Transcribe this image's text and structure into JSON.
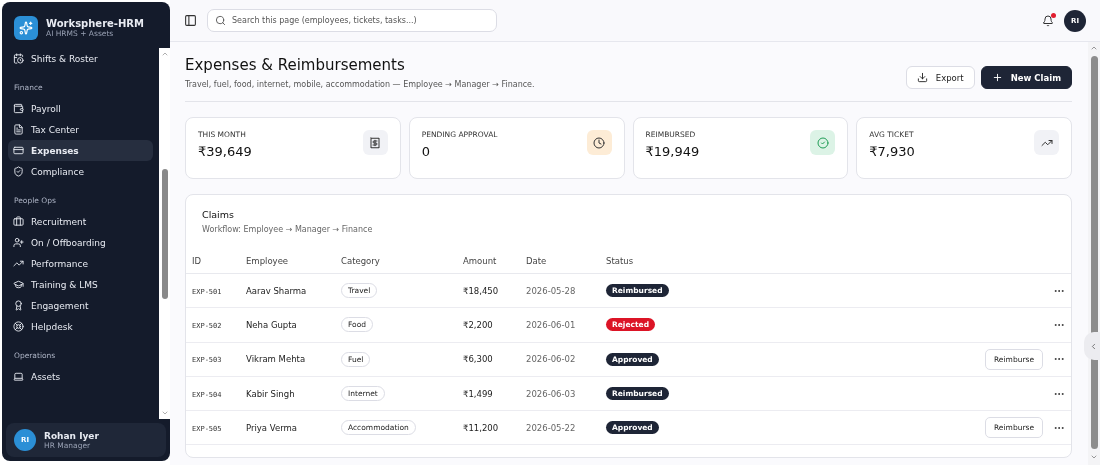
{
  "sidebar": {
    "brand": {
      "name": "Worksphere-HRM",
      "tagline": "AI HRMS + Assets"
    },
    "groups": [
      {
        "items": [
          {
            "label": "Shifts & Roster",
            "selected": false
          }
        ]
      },
      {
        "label": "Finance",
        "items": [
          {
            "label": "Payroll",
            "selected": false
          },
          {
            "label": "Tax Center",
            "selected": false
          },
          {
            "label": "Expenses",
            "selected": true
          },
          {
            "label": "Compliance",
            "selected": false
          }
        ]
      },
      {
        "label": "People Ops",
        "items": [
          {
            "label": "Recruitment",
            "selected": false
          },
          {
            "label": "On / Offboarding",
            "selected": false
          },
          {
            "label": "Performance",
            "selected": false
          },
          {
            "label": "Training & LMS",
            "selected": false
          },
          {
            "label": "Engagement",
            "selected": false
          },
          {
            "label": "Helpdesk",
            "selected": false
          }
        ]
      },
      {
        "label": "Operations",
        "items": [
          {
            "label": "Assets",
            "selected": false
          }
        ]
      }
    ],
    "user": {
      "initials": "RI",
      "name": "Rohan Iyer",
      "role": "HR Manager"
    }
  },
  "topbar": {
    "search": {
      "placeholder": "Search this page (employees, tickets, tasks...)"
    },
    "notification_dot": true,
    "avatar": "RI"
  },
  "page": {
    "title": "Expenses & Reimbursements",
    "subtitle": "Travel, fuel, food, internet, mobile, accommodation — Employee → Manager → Finance.",
    "buttons": [
      {
        "label": "Export",
        "kind": "outline"
      },
      {
        "label": "New Claim",
        "kind": "primary"
      }
    ]
  },
  "stats": [
    {
      "label": "THIS MONTH",
      "value": "₹39,649",
      "kind": "money",
      "color": "#f1f2f6"
    },
    {
      "label": "PENDING APPROVAL",
      "value": "0",
      "kind": "clock",
      "color": "#fdecd6"
    },
    {
      "label": "REIMBURSED",
      "value": "₹19,949",
      "kind": "check",
      "color": "#dcf3e6"
    },
    {
      "label": "AVG TICKET",
      "value": "₹7,930",
      "kind": "trend",
      "color": "#f1f2f6"
    }
  ],
  "claims": {
    "title": "Claims",
    "subtitle": "Workflow: Employee → Manager → Finance",
    "columns": [
      "ID",
      "Employee",
      "Category",
      "Amount",
      "Date",
      "Status"
    ],
    "rows": [
      {
        "id": "EXP-501",
        "employee": "Aarav Sharma",
        "category": "Travel",
        "amount": "₹18,450",
        "date": "2026-05-28",
        "status": "Reimbursed",
        "color": "#1e2536"
      },
      {
        "id": "EXP-502",
        "employee": "Neha Gupta",
        "category": "Food",
        "amount": "₹2,200",
        "date": "2026-06-01",
        "status": "Rejected",
        "color": "#dc1426"
      },
      {
        "id": "EXP-503",
        "employee": "Vikram Mehta",
        "category": "Fuel",
        "amount": "₹6,300",
        "date": "2026-06-02",
        "status": "Approved",
        "color": "#1e2536",
        "action": "Reimburse"
      },
      {
        "id": "EXP-504",
        "employee": "Kabir Singh",
        "category": "Internet",
        "amount": "₹1,499",
        "date": "2026-06-03",
        "status": "Reimbursed",
        "color": "#1e2536"
      },
      {
        "id": "EXP-505",
        "employee": "Priya Verma",
        "category": "Accommodation",
        "amount": "₹11,200",
        "date": "2026-05-22",
        "status": "Approved",
        "color": "#1e2536",
        "action": "Reimburse"
      }
    ]
  }
}
